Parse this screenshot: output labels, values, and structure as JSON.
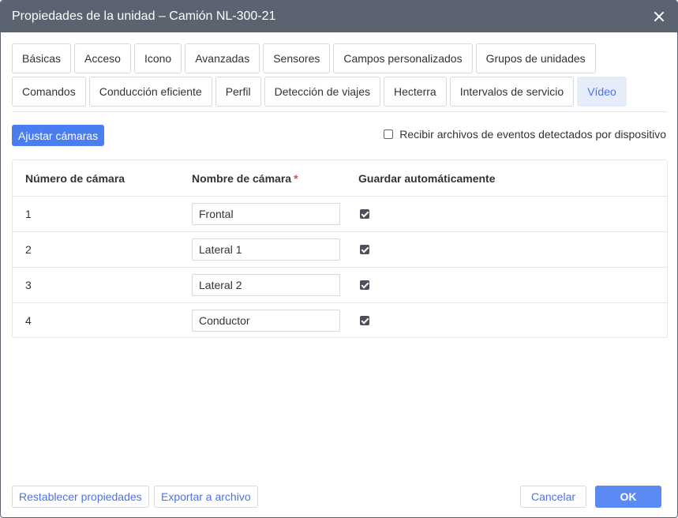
{
  "dialog": {
    "title": "Propiedades de la unidad – Camión NL-300-21"
  },
  "tabs": {
    "row1": [
      "Básicas",
      "Acceso",
      "Icono",
      "Avanzadas",
      "Sensores",
      "Campos personalizados",
      "Grupos de unidades"
    ],
    "row2": [
      "Comandos",
      "Conducción eficiente",
      "Perfil",
      "Detección de viajes",
      "Hecterra",
      "Intervalos de servicio",
      "Vídeo"
    ],
    "active": "Vídeo"
  },
  "toolbar": {
    "adjust_cameras_label": "Ajustar cámaras",
    "receive_files_label": "Recibir archivos de eventos detectados por dispositivo",
    "receive_files_checked": false
  },
  "table": {
    "headers": {
      "camera_number": "Número de cámara",
      "camera_name": "Nombre de cámara",
      "required_mark": "*",
      "auto_save": "Guardar automáticamente"
    },
    "rows": [
      {
        "number": "1",
        "name": "Frontal",
        "auto_save": true
      },
      {
        "number": "2",
        "name": "Lateral 1",
        "auto_save": true
      },
      {
        "number": "3",
        "name": "Lateral 2",
        "auto_save": true
      },
      {
        "number": "4",
        "name": "Conductor",
        "auto_save": true
      }
    ]
  },
  "footer": {
    "reset_label": "Restablecer propiedades",
    "export_label": "Exportar a archivo",
    "cancel_label": "Cancelar",
    "ok_label": "OK"
  },
  "colors": {
    "titlebar": "#5b6270",
    "accent": "#4a7df0",
    "active_tab_bg": "#e7ecfb",
    "required": "#e0453a"
  }
}
